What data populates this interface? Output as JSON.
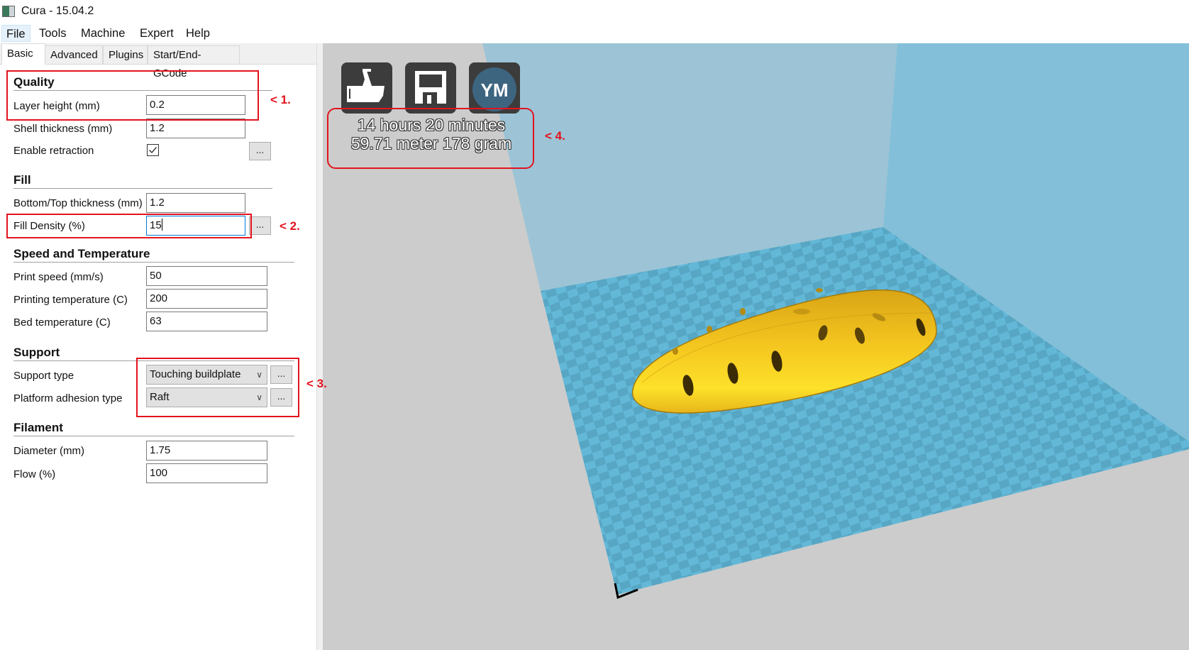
{
  "window": {
    "title": "Cura - 15.04.2"
  },
  "menu": [
    "File",
    "Tools",
    "Machine",
    "Expert",
    "Help"
  ],
  "tabs": [
    "Basic",
    "Advanced",
    "Plugins",
    "Start/End-GCode"
  ],
  "active_tab": "Basic",
  "sections": {
    "quality": {
      "title": "Quality",
      "layer_height": {
        "label": "Layer height (mm)",
        "value": "0.2"
      },
      "shell_thickness": {
        "label": "Shell thickness (mm)",
        "value": "1.2"
      },
      "enable_retraction": {
        "label": "Enable retraction",
        "checked": true,
        "more": "..."
      }
    },
    "fill": {
      "title": "Fill",
      "bottom_top_thickness": {
        "label": "Bottom/Top thickness (mm)",
        "value": "1.2"
      },
      "fill_density": {
        "label": "Fill Density (%)",
        "value": "15",
        "more": "..."
      }
    },
    "speed": {
      "title": "Speed and Temperature",
      "print_speed": {
        "label": "Print speed (mm/s)",
        "value": "50"
      },
      "printing_temperature": {
        "label": "Printing temperature (C)",
        "value": "200"
      },
      "bed_temperature": {
        "label": "Bed temperature (C)",
        "value": "63"
      }
    },
    "support": {
      "title": "Support",
      "support_type": {
        "label": "Support type",
        "value": "Touching buildplate",
        "more": "..."
      },
      "platform_adhesion": {
        "label": "Platform adhesion type",
        "value": "Raft",
        "more": "..."
      }
    },
    "filament": {
      "title": "Filament",
      "diameter": {
        "label": "Diameter (mm)",
        "value": "1.75"
      },
      "flow": {
        "label": "Flow (%)",
        "value": "100"
      }
    }
  },
  "annotations": [
    "< 1.",
    "< 2.",
    "< 3.",
    "< 4."
  ],
  "viewport": {
    "toolbar": [
      {
        "name": "load-model",
        "icon": "load-icon"
      },
      {
        "name": "save-toolpath",
        "icon": "floppy-disk-icon"
      },
      {
        "name": "youmagine",
        "label": "YM"
      }
    ],
    "print_time": "14 hours 20 minutes",
    "material": "59.71 meter 178 gram"
  },
  "colors": {
    "annotation_red": "#e3131e",
    "model_yellow": "#f9d21e",
    "bed_blue": "#63b8d8",
    "bed_blue_dark": "#57a6c4",
    "wall_left": "#9cc4d6",
    "wall_right": "#83bfd9",
    "background_gray": "#cccccc",
    "toolbar_dark": "#3c3c3c",
    "ym_blue": "#3d6580"
  }
}
